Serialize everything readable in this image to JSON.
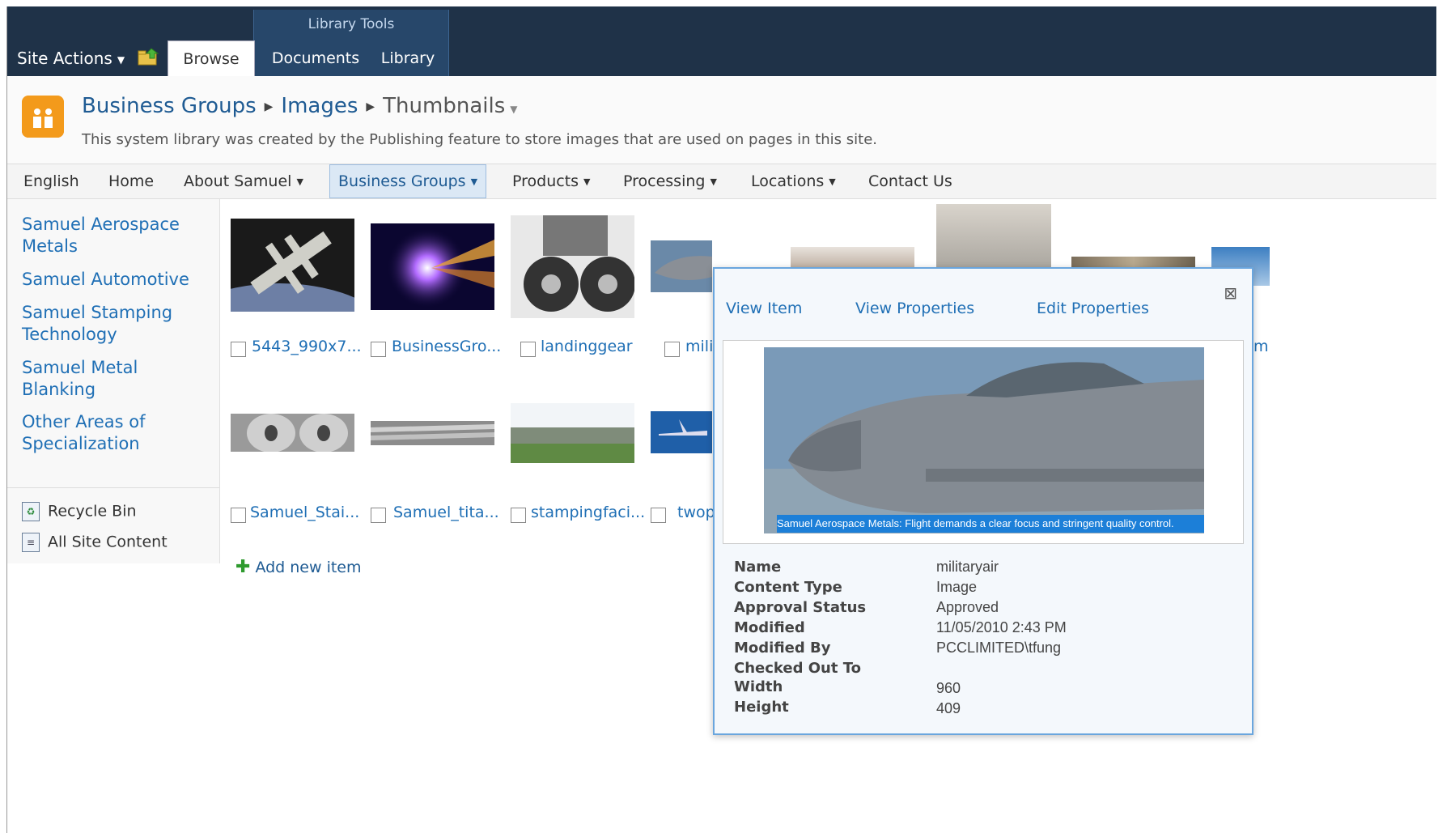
{
  "ribbon": {
    "site_actions": "Site Actions",
    "tab_group_title": "Library Tools",
    "tabs": [
      "Browse",
      "Documents",
      "Library"
    ]
  },
  "title_area": {
    "breadcrumb": [
      "Business Groups",
      "Images",
      "Thumbnails"
    ],
    "description": "This system library was created by the Publishing feature to store images that are used on pages in this site."
  },
  "top_nav": [
    "English",
    "Home",
    "About Samuel",
    "Business Groups",
    "Products",
    "Processing",
    "Locations",
    "Contact Us"
  ],
  "left_nav": {
    "links": [
      "Samuel Aerospace Metals",
      "Samuel Automotive",
      "Samuel Stamping Technology",
      "Samuel Metal Blanking",
      "Other Areas of Specialization"
    ],
    "recycle_bin": "Recycle Bin",
    "all_site_content": "All Site Content"
  },
  "thumbnails": {
    "row1": [
      "5443_990x7...",
      "BusinessGro...",
      "landinggear",
      "mili"
    ],
    "row2": [
      "Samuel_Stai...",
      "Samuel_tita...",
      "stampingfaci...",
      "twop"
    ],
    "partial_right": "m"
  },
  "add_new_item": "Add new item",
  "callout": {
    "links": [
      "View Item",
      "View Properties",
      "Edit Properties"
    ],
    "caption": "Samuel Aerospace Metals: Flight demands a clear focus and stringent quality control.",
    "properties": [
      {
        "key": "Name",
        "value": "militaryair"
      },
      {
        "key": "Content Type",
        "value": "Image"
      },
      {
        "key": "Approval Status",
        "value": "Approved"
      },
      {
        "key": "Modified",
        "value": "11/05/2010 2:43 PM"
      },
      {
        "key": "Modified By",
        "value": "PCCLIMITED\\tfung"
      },
      {
        "key": "Checked Out To",
        "value": ""
      },
      {
        "key": "Width",
        "value": "960"
      },
      {
        "key": "Height",
        "value": "409"
      }
    ]
  },
  "colors": {
    "ribbon": "#1f3248",
    "link": "#1f6fb5",
    "accent": "#1c7fd8"
  }
}
